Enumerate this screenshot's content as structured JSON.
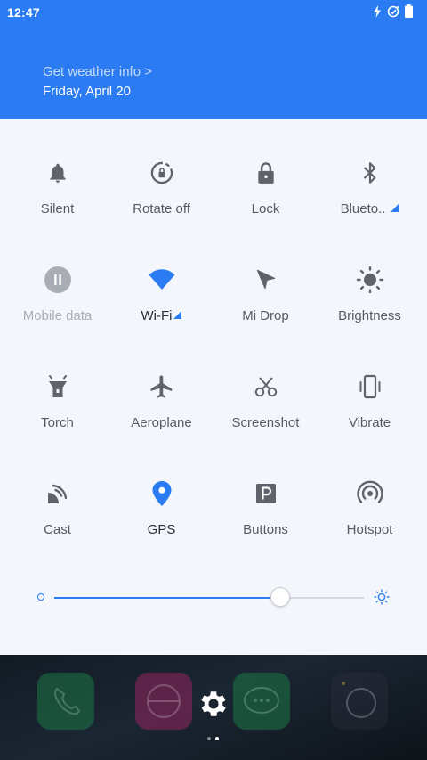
{
  "status_bar": {
    "time": "12:47",
    "icons": [
      "charging-bolt-icon",
      "sync-check-icon",
      "battery-icon"
    ]
  },
  "header": {
    "weather_link": "Get weather info >",
    "date": "Friday, April 20"
  },
  "tiles": [
    {
      "label": "Silent",
      "icon": "bell-icon",
      "state": "inactive"
    },
    {
      "label": "Rotate off",
      "icon": "rotate-lock-icon",
      "state": "inactive"
    },
    {
      "label": "Lock",
      "icon": "lock-icon",
      "state": "inactive"
    },
    {
      "label": "Blueto..",
      "icon": "bluetooth-icon",
      "state": "inactive",
      "expandable": true
    },
    {
      "label": "Mobile data",
      "icon": "mobile-data-icon",
      "state": "disabled"
    },
    {
      "label": "Wi-Fi",
      "icon": "wifi-icon",
      "state": "active",
      "expandable": true
    },
    {
      "label": "Mi Drop",
      "icon": "mi-drop-icon",
      "state": "inactive"
    },
    {
      "label": "Brightness",
      "icon": "brightness-icon",
      "state": "inactive"
    },
    {
      "label": "Torch",
      "icon": "torch-icon",
      "state": "inactive"
    },
    {
      "label": "Aeroplane",
      "icon": "aeroplane-icon",
      "state": "inactive"
    },
    {
      "label": "Screenshot",
      "icon": "scissors-icon",
      "state": "inactive"
    },
    {
      "label": "Vibrate",
      "icon": "vibrate-icon",
      "state": "inactive"
    },
    {
      "label": "Cast",
      "icon": "cast-icon",
      "state": "inactive"
    },
    {
      "label": "GPS",
      "icon": "gps-pin-icon",
      "state": "active"
    },
    {
      "label": "Buttons",
      "icon": "buttons-p-icon",
      "state": "inactive"
    },
    {
      "label": "Hotspot",
      "icon": "hotspot-icon",
      "state": "inactive"
    }
  ],
  "brightness_slider": {
    "level": 0.73
  },
  "home_screen": {
    "page_count": 2,
    "active_page": 2,
    "dock_apps": [
      "phone-icon",
      "browser-icon",
      "messaging-icon",
      "camera-icon"
    ]
  },
  "colors": {
    "accent": "#2b7bf2",
    "panel_bg": "#f3f6fb",
    "icon_gray": "#5f636b",
    "label_gray": "#555b66",
    "disabled": "#a9aeb6"
  }
}
